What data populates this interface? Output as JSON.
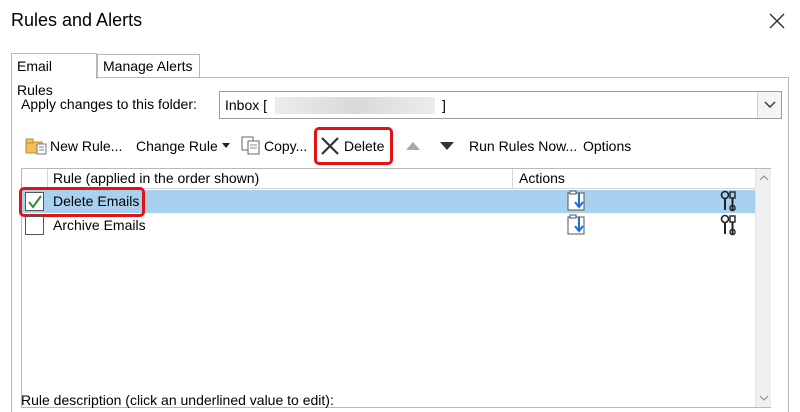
{
  "window": {
    "title": "Rules and Alerts"
  },
  "tabs": [
    {
      "label": "Email Rules",
      "active": true
    },
    {
      "label": "Manage Alerts",
      "active": false
    }
  ],
  "folder": {
    "label": "Apply changes to this folder:",
    "value": "Inbox [",
    "value_end": "]"
  },
  "toolbar": {
    "new_rule": "New Rule...",
    "change_rule": "Change Rule",
    "copy": "Copy...",
    "delete": "Delete",
    "run_rules_now": "Run Rules Now...",
    "options": "Options"
  },
  "grid": {
    "columns": [
      "Rule (applied in the order shown)",
      "Actions"
    ],
    "rows": [
      {
        "name": "Delete Emails",
        "checked": true,
        "selected": true
      },
      {
        "name": "Archive Emails",
        "checked": false,
        "selected": false
      }
    ]
  },
  "rule_description_label": "Rule description (click an underlined value to edit):",
  "colors": {
    "selection": "#a8d0ef",
    "highlight_box": "#e21313",
    "check_green": "#2e8b2e",
    "arrow_blue": "#1e6fd9"
  }
}
